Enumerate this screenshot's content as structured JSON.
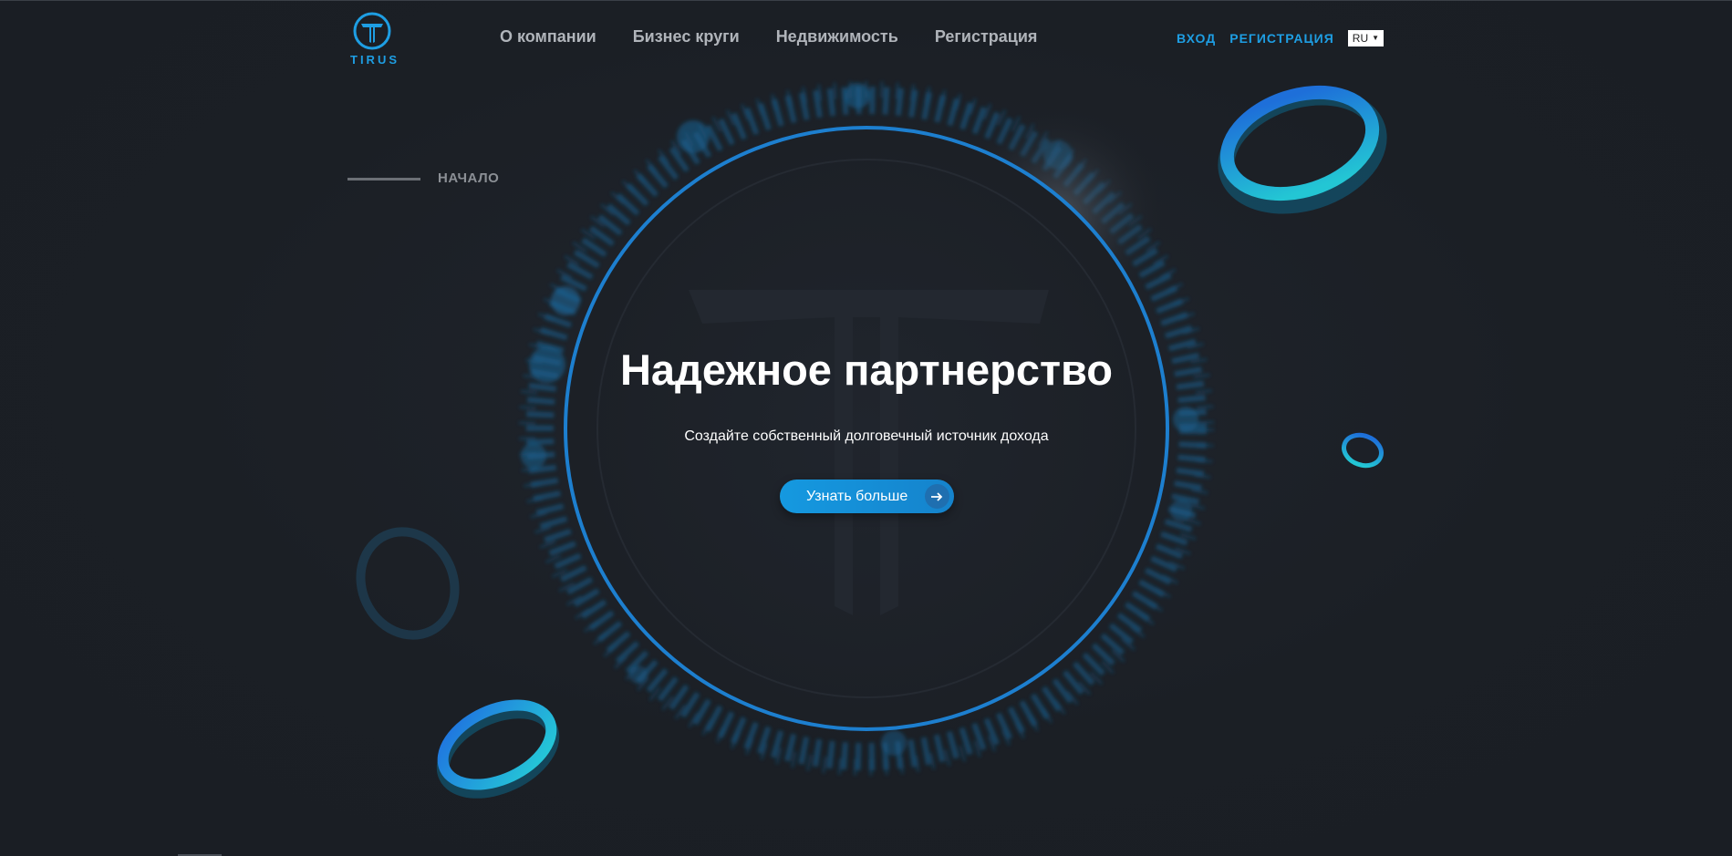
{
  "header": {
    "logo_text": "TIRUS",
    "nav": [
      {
        "label": "О компании"
      },
      {
        "label": "Бизнес круги"
      },
      {
        "label": "Недвижимость"
      },
      {
        "label": "Регистрация"
      }
    ],
    "login_label": "ВХОД",
    "register_label": "РЕГИСТРАЦИЯ",
    "language": {
      "selected": "RU",
      "arrow": "▼"
    }
  },
  "section": {
    "label": "НАЧАЛО"
  },
  "hero": {
    "title": "Надежное партнерство",
    "subtitle": "Создайте собственный долговечный источник дохода",
    "cta_label": "Узнать больше",
    "cta_icon": "arrow-right-icon"
  },
  "colors": {
    "accent": "#1e9ee3",
    "background": "#1b1f25",
    "ring_blue": "#1e6fd9",
    "ring_cyan": "#22c4d6"
  }
}
